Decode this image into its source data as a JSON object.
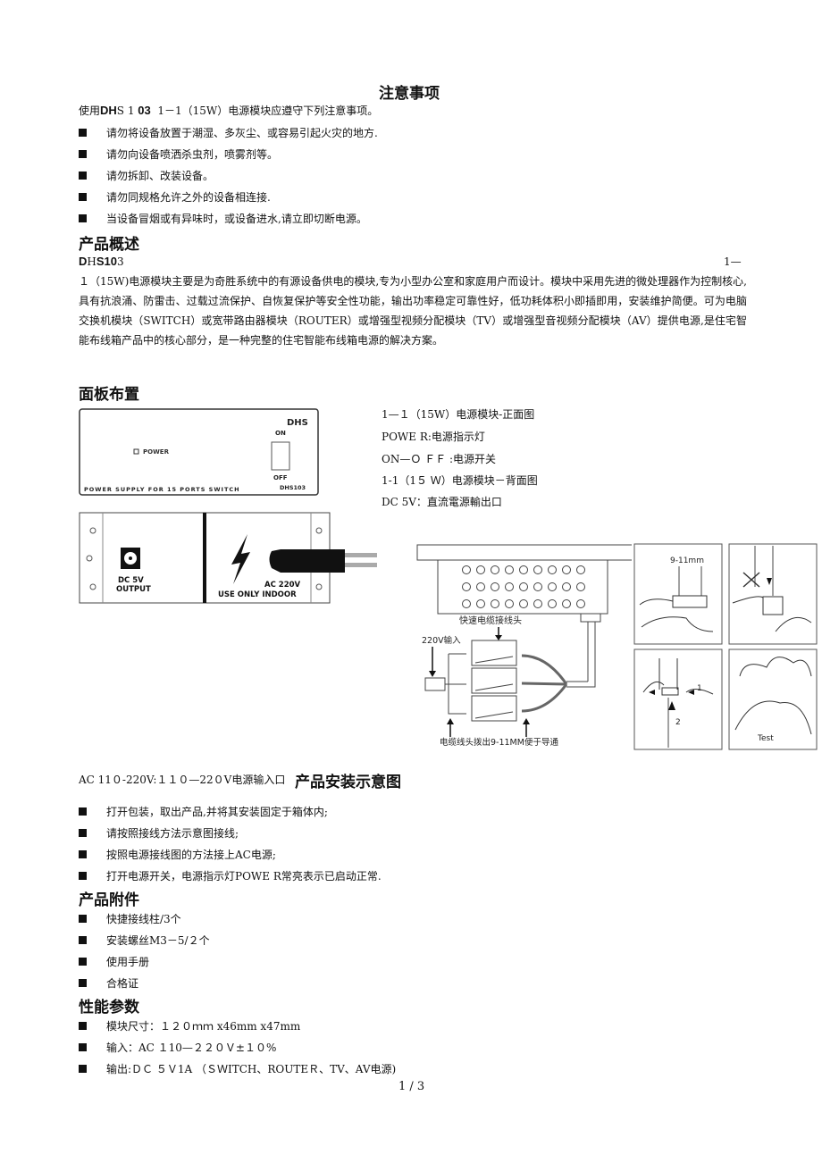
{
  "notice": {
    "title": "注意事项",
    "intro_prefix": "使用",
    "intro_model_a": "DH",
    "intro_model_b": "S 1 ",
    "intro_model_c": "03",
    "intro_suffix": "  1－1（15W）电源模块应遵守下列注意事项。",
    "items": [
      "请勿将设备放置于潮湿、多灰尘、或容易引起火灾的地方.",
      "请勿向设备喷洒杀虫剂，喷雾剂等。",
      "请勿拆卸、改装设备。",
      "请勿同规格允许之外的设备相连接.",
      "当设备冒烟或有异味时，或设备进水,请立即切断电源。"
    ]
  },
  "overview": {
    "title": "产品概述",
    "model_a": "D",
    "model_b": "H",
    "model_c": "S10",
    "model_d": "3",
    "model_right": "1—",
    "paragraph": "１（15W)电源模块主要是为奇胜系统中的有源设备供电的模块,专为小型办公室和家庭用户而设计。模块中采用先进的微处理器作为控制核心,具有抗浪涌、防雷击、过载过流保护、自恢复保护等安全性功能，输出功率稳定可靠性好，低功耗体积小即插即用，安装维护简便。可为电脑交换机模块（SWITCH）或宽带路由器模块（ROUTER）或增强型视频分配模块（TV）或增强型音视频分配模块（AV）提供电源,是住宅智能布线箱产品中的核心部分，是一种完整的住宅智能布线箱电源的解决方案。"
  },
  "panel": {
    "title": "面板布置",
    "front": {
      "brand": "DHS",
      "on": "ON",
      "off": "OFF",
      "power": "POWER",
      "footer": "POWER SUPPLY FOR 15 PORTS SWITCH",
      "model": "DHS103"
    },
    "back": {
      "dc1": "DC 5V",
      "dc2": "OUTPUT",
      "ac": "AC 220V",
      "indoor": "USE ONLY INDOOR"
    },
    "captions": [
      "1—１（15W）电源模块-正面图",
      "POWE R:电源指示灯",
      "ON—Ｏ ＦＦ  :电源开关",
      "1-1（1５ Ｗ）电源模块－背面图",
      "DC  5V：直流電源輸出口"
    ],
    "wiring": {
      "quick_connector": "快速电缆接线头",
      "input": "220V输入",
      "strip": "电缆线头拨出9-11MM便于导通"
    },
    "steps": {
      "measure": "9-11mm",
      "arrow1": "1",
      "arrow2": "2",
      "test": "Test"
    }
  },
  "install": {
    "ac_line": "AC 11０-220V:１１０—22０V电源输入口",
    "title": "产品安装示意图",
    "items": [
      "打开包装，取出产品,并将其安装固定于箱体内;",
      "请按照接线方法示意图接线;",
      "按照电源接线图的方法接上AC电源;",
      "打开电源开关，电源指示灯POWE R常亮表示已启动正常."
    ]
  },
  "accessories": {
    "title": "产品附件",
    "items": [
      "快捷接线柱/3个",
      "安装螺丝M3－5/２个",
      "使用手册",
      "合格证"
    ]
  },
  "specs": {
    "title": "性能参数",
    "items": [
      "模块尺寸：１２０ｍｍ x46mm  x47mm",
      "输入：AC １10—２２０Ｖ±１０%",
      "输出:ＤＣ  ５Ｖ1A （ＳＷITCH、ROUTEＲ、TV、AV电源)"
    ]
  },
  "page": {
    "number": "1 / 3"
  }
}
